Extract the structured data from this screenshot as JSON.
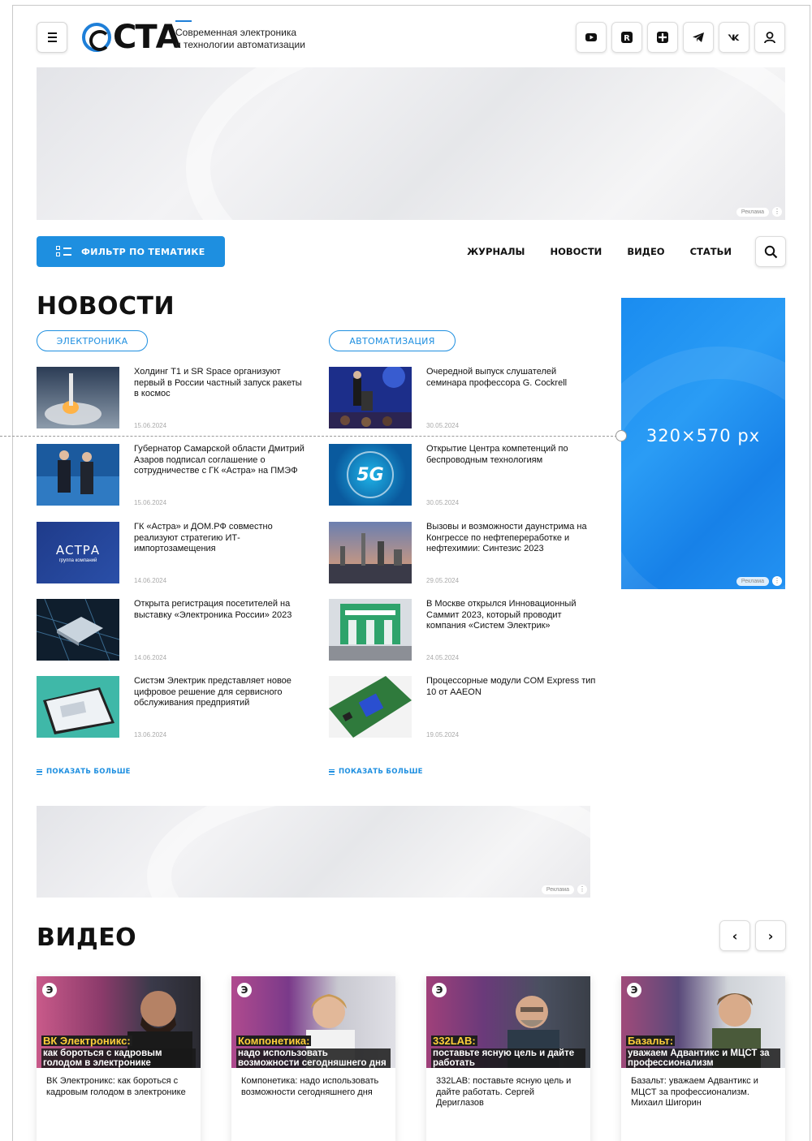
{
  "header": {
    "logo_text": "СТА",
    "tagline_1": "Современная электроника",
    "tagline_2": "и технологии автоматизации"
  },
  "ads": {
    "label": "Реклама",
    "side_size": "320×570 px"
  },
  "toolbar": {
    "filter_label": "ФИЛЬТР ПО ТЕМАТИКЕ",
    "nav": [
      "ЖУРНАЛЫ",
      "НОВОСТИ",
      "ВИДЕО",
      "СТАТЬИ"
    ]
  },
  "news": {
    "title": "НОВОСТИ",
    "columns": [
      {
        "category": "ЭЛЕКТРОНИКА",
        "more": "ПОКАЗАТЬ БОЛЬШЕ",
        "items": [
          {
            "title": "Холдинг Т1 и SR Space организуют первый в России частный запуск ракеты в космос",
            "date": "15.06.2024",
            "thumb": "rocket-launch"
          },
          {
            "title": "Губернатор Самарской области Дмитрий Азаров подписал соглашение о сотрудничестве с ГК «Астра» на ПМЭФ",
            "date": "15.06.2024",
            "thumb": "handshake"
          },
          {
            "title": "ГК «Астра» и ДОМ.РФ совместно реализуют стратегию ИТ-импортозамещения",
            "date": "14.06.2024",
            "thumb": "astra-logo"
          },
          {
            "title": "Открыта регистрация посетителей на выставку «Электроника России» 2023",
            "date": "14.06.2024",
            "thumb": "chip"
          },
          {
            "title": "Систэм Электрик представляет новое цифровое решение для сервисного обслуживания предприятий",
            "date": "13.06.2024",
            "thumb": "tablet"
          }
        ]
      },
      {
        "category": "АВТОМАТИЗАЦИЯ",
        "more": "ПОКАЗАТЬ БОЛЬШЕ",
        "items": [
          {
            "title": "Очередной выпуск слушателей семинара профессора G. Cockrell",
            "date": "30.05.2024",
            "thumb": "seminar"
          },
          {
            "title": "Открытие Центра компетенций по беспроводным технологиям",
            "date": "30.05.2024",
            "thumb": "5g"
          },
          {
            "title": "Вызовы и возможности даунстрима на Конгрессе по нефтепереработке и нефтехимии: Синтезис 2023",
            "date": "29.05.2024",
            "thumb": "refinery"
          },
          {
            "title": "В Москве открылся Инновационный Саммит 2023, который проводит компания «Систем Электрик»",
            "date": "24.05.2024",
            "thumb": "expo-stand"
          },
          {
            "title": "Процессорные модули COM Express тип 10 от AAEON",
            "date": "19.05.2024",
            "thumb": "board"
          }
        ]
      }
    ],
    "astra_word": "АСТРА",
    "astra_sub": "группа компаний",
    "fiveg": "5G"
  },
  "video": {
    "title": "ВИДЕО",
    "items": [
      {
        "cap1": "ВК Электроникс:",
        "cap2": "как бороться с кадровым голодом в электронике",
        "title": "ВК Электроникс: как бороться с кадровым голодом в электронике"
      },
      {
        "cap1": "Компонетика:",
        "cap2": "надо использовать возможности сегодняшнего дня",
        "title": "Компонетика: надо использовать возможности сегодняшнего дня"
      },
      {
        "cap1": "332LAB:",
        "cap2": "поставьте ясную цель и дайте работать",
        "title": "332LAB: поставьте ясную цель и дайте работать. Сергей Дериглазов"
      },
      {
        "cap1": "Базальт:",
        "cap2": "уважаем Адвантикс и МЦСТ за профессионализм",
        "title": "Базальт: уважаем Адвантикс и МЦСТ за профессионализм. Михаил Шигорин"
      }
    ],
    "logo_letter": "Э"
  },
  "colors": {
    "accent": "#1e8fe0",
    "logo_blue": "#1e7fd8",
    "ad_blue": "#1a8cf0"
  }
}
